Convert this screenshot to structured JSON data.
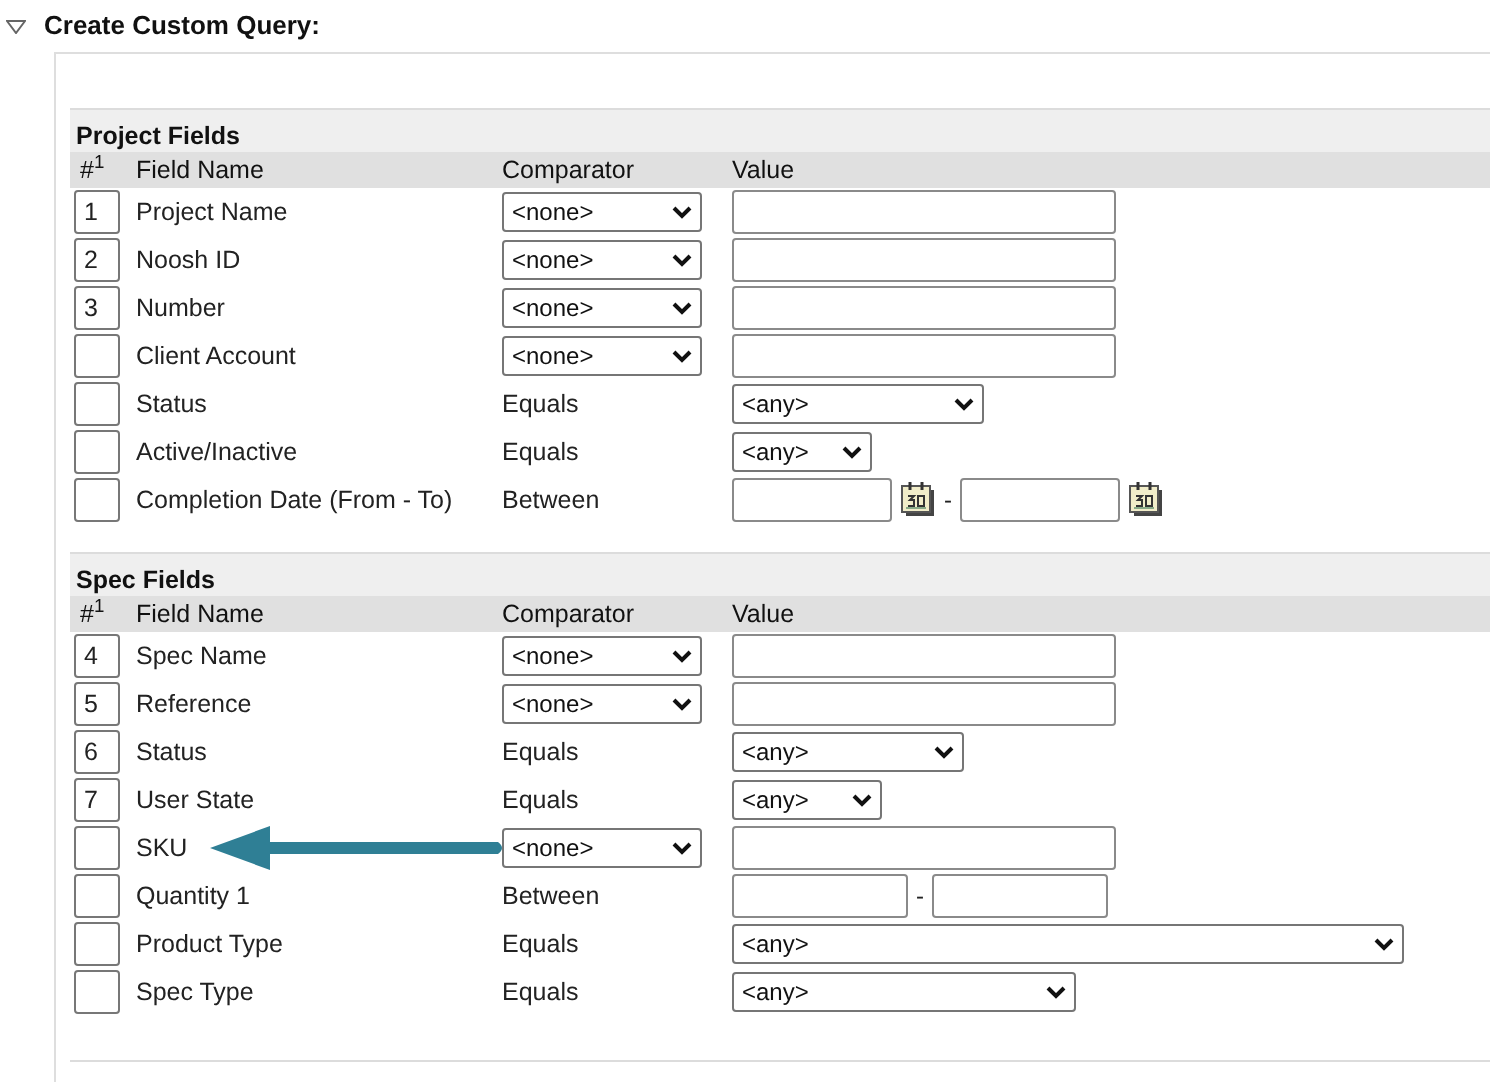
{
  "title": {
    "text": "Create Custom Query:",
    "expanded": true
  },
  "sections": [
    {
      "title": "Project Fields",
      "columns": [
        "#$^{1}$",
        "Field Name",
        "Comparator",
        "Value"
      ],
      "rows": [
        {
          "order": "1",
          "field": "Project Name",
          "comparator": {
            "kind": "select",
            "text": "<none>"
          },
          "value": {
            "kind": "text"
          },
          "highlighted": false
        },
        {
          "order": "2",
          "field": "Noosh ID",
          "comparator": {
            "kind": "select",
            "text": "<none>"
          },
          "value": {
            "kind": "text"
          },
          "highlighted": false
        },
        {
          "order": "3",
          "field": "Number",
          "comparator": {
            "kind": "select",
            "text": "<none>"
          },
          "value": {
            "kind": "text"
          },
          "highlighted": false
        },
        {
          "field": "Client Account",
          "comparator": {
            "kind": "select",
            "text": "<none>"
          },
          "value": {
            "kind": "text"
          },
          "highlighted": false
        },
        {
          "field": "Status",
          "comparator": {
            "kind": "label",
            "text": "Equals"
          },
          "value": {
            "kind": "select",
            "text": "<any>"
          },
          "highlighted": false
        },
        {
          "field": "Active/Inactive",
          "comparator": {
            "kind": "label",
            "text": "Equals"
          },
          "value": {
            "kind": "select",
            "text": "<any>"
          },
          "highlighted": false
        },
        {
          "field": "Completion Date (From - To)",
          "comparator": {
            "kind": "label",
            "text": "Between"
          },
          "value": {
            "kind": "date-range",
            "separator": "-"
          },
          "highlighted": false
        }
      ]
    },
    {
      "title": "Spec Fields",
      "columns": [
        "#$^{1}$",
        "Field Name",
        "Comparator",
        "Value"
      ],
      "rows": [
        {
          "order": "4",
          "field": "Spec Name",
          "comparator": {
            "kind": "select",
            "text": "<none>"
          },
          "value": {
            "kind": "text"
          },
          "highlighted": false
        },
        {
          "order": "5",
          "field": "Reference",
          "comparator": {
            "kind": "select",
            "text": "<none>"
          },
          "value": {
            "kind": "text"
          },
          "highlighted": false
        },
        {
          "order": "6",
          "field": "Status",
          "comparator": {
            "kind": "label",
            "text": "Equals"
          },
          "value": {
            "kind": "select",
            "text": "<any>"
          },
          "highlighted": false
        },
        {
          "order": "7",
          "field": "User State",
          "comparator": {
            "kind": "label",
            "text": "Equals"
          },
          "value": {
            "kind": "select",
            "text": "<any>"
          },
          "highlighted": false
        },
        {
          "field": "SKU",
          "comparator": {
            "kind": "select",
            "text": "<none>"
          },
          "value": {
            "kind": "text"
          },
          "highlighted": true
        },
        {
          "field": "Quantity 1",
          "comparator": {
            "kind": "label",
            "text": "Between"
          },
          "value": {
            "kind": "range",
            "separator": "-"
          },
          "highlighted": false
        },
        {
          "field": "Product Type",
          "comparator": {
            "kind": "label",
            "text": "Equals"
          },
          "value": {
            "kind": "select",
            "text": "<any>"
          },
          "highlighted": false
        },
        {
          "field": "Spec Type",
          "comparator": {
            "kind": "label",
            "text": "Equals"
          },
          "value": {
            "kind": "select",
            "text": "<any>"
          },
          "highlighted": false
        }
      ]
    }
  ]
}
